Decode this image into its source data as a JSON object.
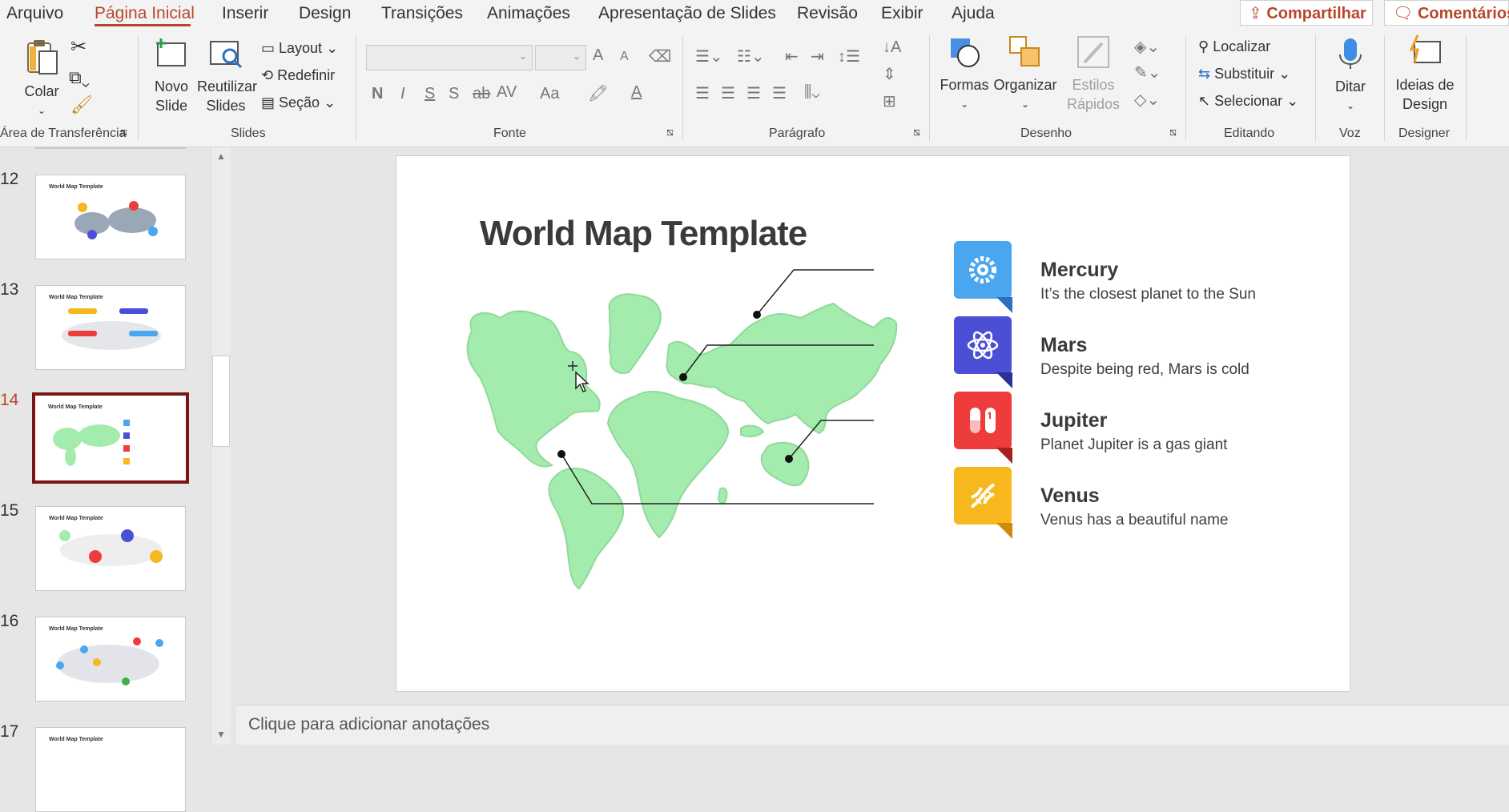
{
  "menu": {
    "tabs": [
      "Arquivo",
      "Página Inicial",
      "Inserir",
      "Design",
      "Transições",
      "Animações",
      "Apresentação de Slides",
      "Revisão",
      "Exibir",
      "Ajuda"
    ],
    "share_label": "Compartilhar",
    "comments_label": "Comentários"
  },
  "ribbon": {
    "clipboard": {
      "paste_label": "Colar",
      "group_label": "Área de Transferência"
    },
    "slides": {
      "new_slide_label": "Novo Slide",
      "reuse_label": "Reutilizar Slides",
      "layout_label": "Layout",
      "reset_label": "Redefinir",
      "section_label": "Seção",
      "group_label": "Slides"
    },
    "font": {
      "bold": "N",
      "italic": "I",
      "underline": "S",
      "shadow": "S",
      "strike": "ab",
      "spacing": "AV",
      "case": "Aa",
      "color_letter": "A",
      "grow": "A",
      "shrink": "A",
      "group_label": "Fonte"
    },
    "paragraph": {
      "group_label": "Parágrafo"
    },
    "drawing": {
      "shapes_label": "Formas",
      "arrange_label": "Organizar",
      "quick_styles_label": "Estilos Rápidos",
      "group_label": "Desenho"
    },
    "editing": {
      "find_label": "Localizar",
      "replace_label": "Substituir",
      "select_label": "Selecionar",
      "group_label": "Editando"
    },
    "voice": {
      "dictate_label": "Ditar",
      "group_label": "Voz"
    },
    "designer": {
      "ideas_label": "Ideias de Design",
      "group_label": "Designer"
    }
  },
  "thumbnails": {
    "items": [
      {
        "number": "12",
        "title": "World Map Template"
      },
      {
        "number": "13",
        "title": "World Map Template"
      },
      {
        "number": "14",
        "title": "World Map Template",
        "current": true
      },
      {
        "number": "15",
        "title": "World Map Template"
      },
      {
        "number": "16",
        "title": "World Map Template"
      },
      {
        "number": "17",
        "title": "World Map Template"
      }
    ]
  },
  "slide": {
    "title": "World Map Template",
    "planets": [
      {
        "name": "Mercury",
        "desc": "It’s the closest planet to the Sun",
        "color": "#4aa6ee",
        "icon": "gear-icon"
      },
      {
        "name": "Mars",
        "desc": "Despite being red, Mars is cold",
        "color": "#4a4fd6",
        "icon": "atom-icon"
      },
      {
        "name": "Jupiter",
        "desc": "Planet Jupiter is a gas giant",
        "color": "#ee3b3b",
        "icon": "pill-icon"
      },
      {
        "name": "Venus",
        "desc": "Venus has a beautiful name",
        "color": "#f6b81d",
        "icon": "dna-icon"
      }
    ],
    "map_color": "#a3ecae"
  },
  "notes": {
    "placeholder": "Clique para adicionar anotações"
  }
}
